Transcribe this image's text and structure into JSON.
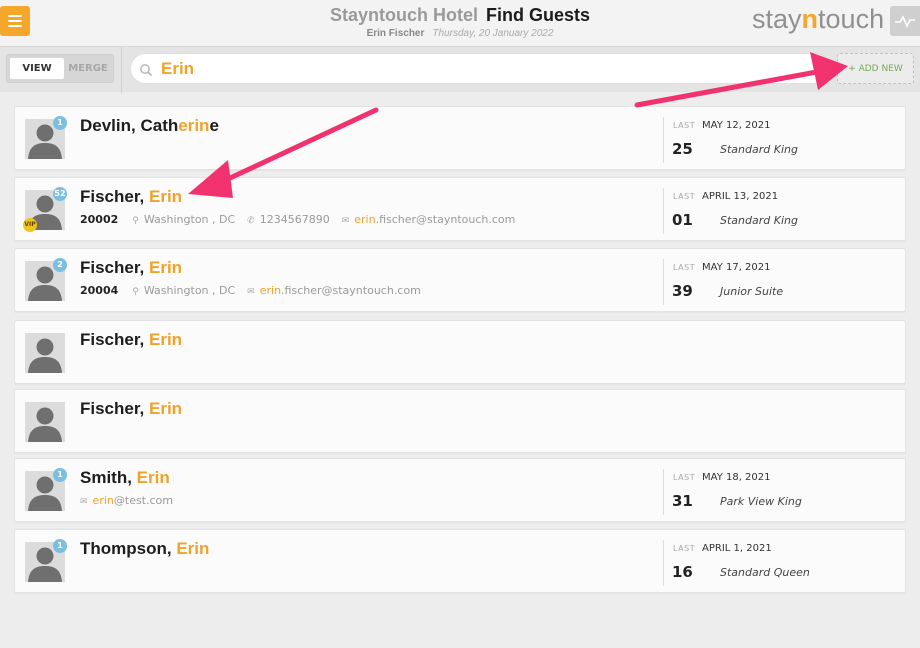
{
  "header": {
    "hotel_name": "Stayntouch Hotel",
    "page_title": "Find Guests",
    "user_name": "Erin Fischer",
    "date": "Thursday, 20 January 2022",
    "logo": {
      "pre": "stay",
      "mid": "n",
      "post": "touch"
    },
    "menu_icon": "hamburger-icon",
    "activity_icon": "pulse-icon"
  },
  "toolbar": {
    "view_label": "VIEW",
    "merge_label": "MERGE",
    "search_value": "Erin",
    "search_icon": "search-icon",
    "add_new_label": "+ ADD NEW"
  },
  "colors": {
    "accent": "#f0a22a",
    "badge": "#7bbfe0",
    "vip": "#f0c419",
    "arrow": "#f2316f"
  },
  "results": [
    {
      "name_pre": "Devlin, Cath",
      "name_hl": "erin",
      "name_post": "e",
      "badge": "1",
      "vip": false,
      "last_label": "LAST",
      "last_date": "MAY 12, 2021",
      "last_day": "25",
      "room": "Standard King"
    },
    {
      "name_pre": "Fischer, ",
      "name_hl": "Erin",
      "name_post": "",
      "badge": "52",
      "vip": true,
      "vip_label": "VIP",
      "zip": "20002",
      "location": "Washington , DC",
      "phone": "1234567890",
      "email_hl": "erin",
      "email_rest": ".fischer@stayntouch.com",
      "last_label": "LAST",
      "last_date": "APRIL 13, 2021",
      "last_day": "01",
      "room": "Standard King"
    },
    {
      "name_pre": "Fischer, ",
      "name_hl": "Erin",
      "name_post": "",
      "badge": "2",
      "vip": false,
      "zip": "20004",
      "location": "Washington , DC",
      "email_hl": "erin",
      "email_rest": ".fischer@stayntouch.com",
      "last_label": "LAST",
      "last_date": "MAY 17, 2021",
      "last_day": "39",
      "room": "Junior Suite"
    },
    {
      "name_pre": "Fischer, ",
      "name_hl": "Erin",
      "name_post": ""
    },
    {
      "name_pre": "Fischer, ",
      "name_hl": "Erin",
      "name_post": ""
    },
    {
      "name_pre": "Smith, ",
      "name_hl": "Erin",
      "name_post": "",
      "badge": "1",
      "vip": false,
      "email_hl": "erin",
      "email_rest": "@test.com",
      "last_label": "LAST",
      "last_date": "MAY 18, 2021",
      "last_day": "31",
      "room": "Park View King"
    },
    {
      "name_pre": "Thompson, ",
      "name_hl": "Erin",
      "name_post": "",
      "badge": "1",
      "vip": false,
      "last_label": "LAST",
      "last_date": "APRIL 1, 2021",
      "last_day": "16",
      "room": "Standard Queen"
    }
  ]
}
